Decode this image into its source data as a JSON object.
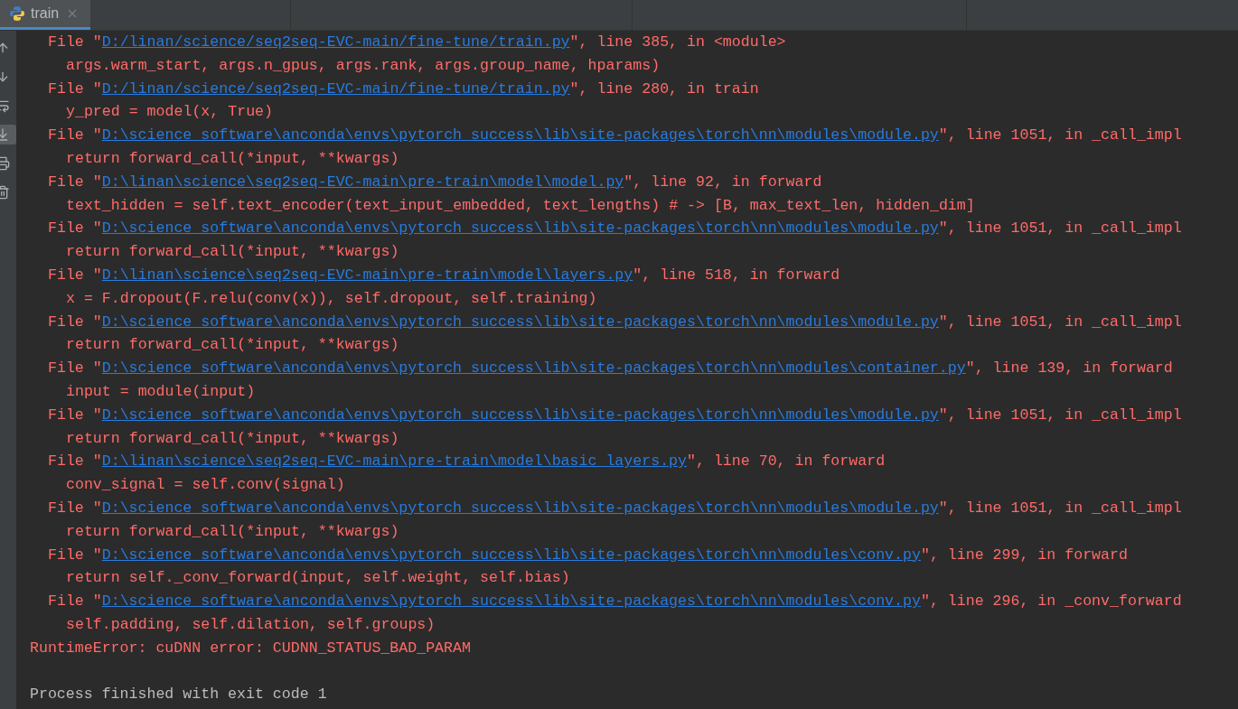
{
  "tab": {
    "title": "train",
    "selected": true
  },
  "toolbar": {
    "scroll_to_end": true
  },
  "console": {
    "lines": [
      {
        "kind": "frame",
        "prefix": "File \"",
        "path": "D:/linan/science/seq2seq-EVC-main/fine-tune/train.py",
        "suffix": "\", line 385, in <module>"
      },
      {
        "kind": "code",
        "text": "args.warm_start, args.n_gpus, args.rank, args.group_name, hparams)"
      },
      {
        "kind": "frame",
        "prefix": "File \"",
        "path": "D:/linan/science/seq2seq-EVC-main/fine-tune/train.py",
        "suffix": "\", line 280, in train"
      },
      {
        "kind": "code",
        "text": "y_pred = model(x, True)"
      },
      {
        "kind": "frame",
        "prefix": "File \"",
        "path": "D:\\science_software\\anconda\\envs\\pytorch_success\\lib\\site-packages\\torch\\nn\\modules\\module.py",
        "suffix": "\", line 1051, in _call_impl"
      },
      {
        "kind": "code",
        "text": "return forward_call(*input, **kwargs)"
      },
      {
        "kind": "frame",
        "prefix": "File \"",
        "path": "D:\\linan\\science\\seq2seq-EVC-main\\pre-train\\model\\model.py",
        "suffix": "\", line 92, in forward"
      },
      {
        "kind": "code",
        "text": "text_hidden = self.text_encoder(text_input_embedded, text_lengths) # -> [B, max_text_len, hidden_dim]"
      },
      {
        "kind": "frame",
        "prefix": "File \"",
        "path": "D:\\science_software\\anconda\\envs\\pytorch_success\\lib\\site-packages\\torch\\nn\\modules\\module.py",
        "suffix": "\", line 1051, in _call_impl"
      },
      {
        "kind": "code",
        "text": "return forward_call(*input, **kwargs)"
      },
      {
        "kind": "frame",
        "prefix": "File \"",
        "path": "D:\\linan\\science\\seq2seq-EVC-main\\pre-train\\model\\layers.py",
        "suffix": "\", line 518, in forward"
      },
      {
        "kind": "code",
        "text": "x = F.dropout(F.relu(conv(x)), self.dropout, self.training)"
      },
      {
        "kind": "frame",
        "prefix": "File \"",
        "path": "D:\\science_software\\anconda\\envs\\pytorch_success\\lib\\site-packages\\torch\\nn\\modules\\module.py",
        "suffix": "\", line 1051, in _call_impl"
      },
      {
        "kind": "code",
        "text": "return forward_call(*input, **kwargs)"
      },
      {
        "kind": "frame",
        "prefix": "File \"",
        "path": "D:\\science_software\\anconda\\envs\\pytorch_success\\lib\\site-packages\\torch\\nn\\modules\\container.py",
        "suffix": "\", line 139, in forward"
      },
      {
        "kind": "code",
        "text": "input = module(input)"
      },
      {
        "kind": "frame",
        "prefix": "File \"",
        "path": "D:\\science_software\\anconda\\envs\\pytorch_success\\lib\\site-packages\\torch\\nn\\modules\\module.py",
        "suffix": "\", line 1051, in _call_impl"
      },
      {
        "kind": "code",
        "text": "return forward_call(*input, **kwargs)"
      },
      {
        "kind": "frame",
        "prefix": "File \"",
        "path": "D:\\linan\\science\\seq2seq-EVC-main\\pre-train\\model\\basic_layers.py",
        "suffix": "\", line 70, in forward"
      },
      {
        "kind": "code",
        "text": "conv_signal = self.conv(signal)"
      },
      {
        "kind": "frame",
        "prefix": "File \"",
        "path": "D:\\science_software\\anconda\\envs\\pytorch_success\\lib\\site-packages\\torch\\nn\\modules\\module.py",
        "suffix": "\", line 1051, in _call_impl"
      },
      {
        "kind": "code",
        "text": "return forward_call(*input, **kwargs)"
      },
      {
        "kind": "frame",
        "prefix": "File \"",
        "path": "D:\\science_software\\anconda\\envs\\pytorch_success\\lib\\site-packages\\torch\\nn\\modules\\conv.py",
        "suffix": "\", line 299, in forward"
      },
      {
        "kind": "code",
        "text": "return self._conv_forward(input, self.weight, self.bias)"
      },
      {
        "kind": "frame",
        "prefix": "File \"",
        "path": "D:\\science_software\\anconda\\envs\\pytorch_success\\lib\\site-packages\\torch\\nn\\modules\\conv.py",
        "suffix": "\", line 296, in _conv_forward"
      },
      {
        "kind": "code",
        "text": "self.padding, self.dilation, self.groups)"
      },
      {
        "kind": "error",
        "text": "RuntimeError: cuDNN error: CUDNN_STATUS_BAD_PARAM"
      },
      {
        "kind": "exit",
        "text": "Process finished with exit code 1"
      }
    ]
  }
}
